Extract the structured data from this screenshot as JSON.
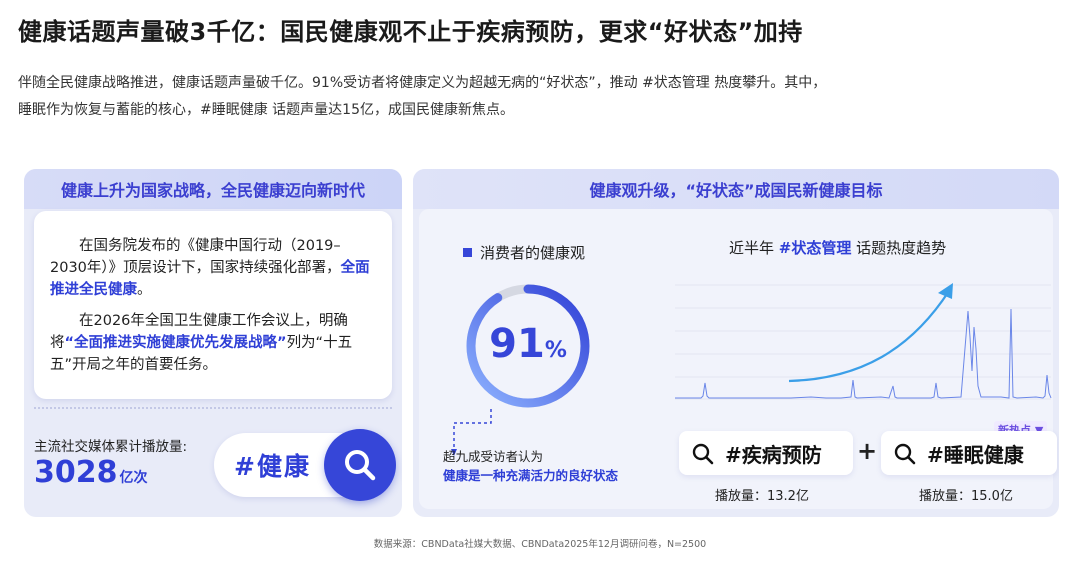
{
  "title": "健康话题声量破3千亿：国民健康观不止于疾病预防，更求“好状态”加持",
  "lead": {
    "line1": "伴随全民健康战略推进，健康话题声量破千亿。91%受访者将健康定义为超越无病的“好状态”，推动 #状态管理 热度攀升。其中，",
    "line2": "睡眠作为恢复与蓄能的核心，#睡眠健康 话题声量达15亿，成国民健康新焦点。"
  },
  "left": {
    "header": "健康上升为国家战略，全民健康迈向新时代",
    "p1_before": "在国务院发布的《健康中国行动（2019–2030年）》顶层设计下，国家持续强化部署，",
    "p1_highlight": "全面推进全民健康",
    "p1_after": "。",
    "p2_before": "在2026年全国卫生健康工作会议上，明确将",
    "p2_highlight": "“全面推进实施健康优先发展战略”",
    "p2_after": "列为“十五五”开局之年的首要任务。",
    "play_label": "主流社交媒体累计播放量:",
    "play_value": "3028",
    "play_unit": "亿次",
    "tag": "#健康"
  },
  "right": {
    "header": "健康观升级，“好状态”成国民新健康目标",
    "legend_label": "消费者的健康观",
    "percent_value": "91",
    "percent_sign": "%",
    "percent_fraction": 0.91,
    "note_line1": "超九成受访者认为",
    "note_line2": "健康是一种充满活力的良好状态",
    "trend_title_before": "近半年",
    "trend_title_tag": "#状态管理",
    "trend_title_after": "话题热度趋势",
    "new_hot": "新热点 ▼",
    "search1": "#疾病预防",
    "search2": "#睡眠健康",
    "plus": "+",
    "play1": "播放量：13.2亿",
    "play2": "播放量：15.0亿"
  },
  "colors": {
    "accent": "#3646d8",
    "highlight": "#2f3fd6",
    "panel_bg": "#e8ebf8",
    "line": "#6a86e8"
  },
  "source": "数据来源：CBNData社媒大数据、CBNData2025年12月调研问卷，N=2500"
}
